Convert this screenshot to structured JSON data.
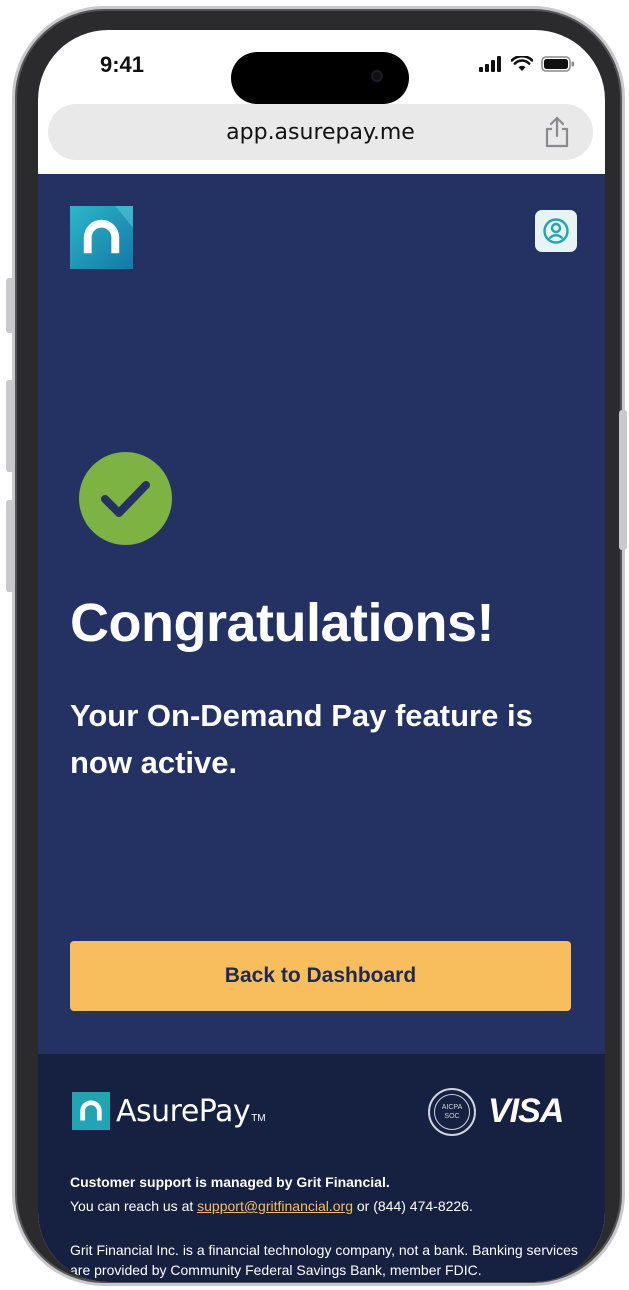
{
  "status_bar": {
    "time": "9:41"
  },
  "browser": {
    "url": "app.asurepay.me"
  },
  "app": {
    "headline": "Congratulations!",
    "subline": "Your On-Demand Pay feature is now active.",
    "cta_label": "Back to Dashboard",
    "colors": {
      "background": "#233163",
      "accent": "#f8be5e",
      "success": "#7cb342",
      "teal": "#21a5b5"
    }
  },
  "footer": {
    "brand_name": "AsurePay",
    "brand_tm": "TM",
    "soc_badge_line1": "AICPA",
    "soc_badge_line2": "SOC",
    "card_network": "VISA",
    "support_title": "Customer support is managed by Grit Financial.",
    "support_prefix": "You can reach us at ",
    "support_email": "support@gritfinancial.org",
    "support_suffix": " or (844) 474-8226.",
    "disclaimer": "Grit Financial Inc. is a financial technology company, not a bank. Banking services are provided by Community Federal Savings Bank, member FDIC."
  }
}
